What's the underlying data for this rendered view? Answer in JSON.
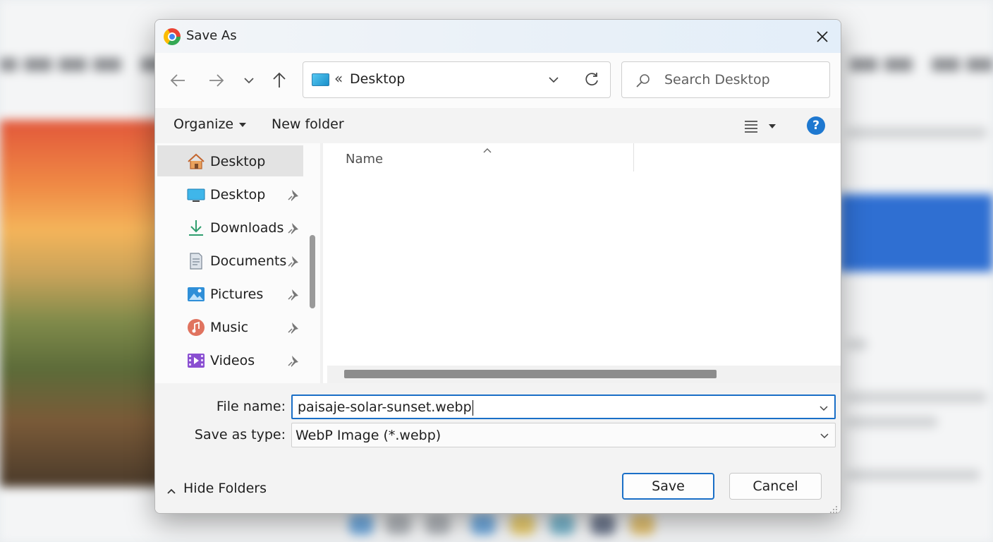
{
  "dialog": {
    "title": "Save As",
    "app_icon": "chrome-icon"
  },
  "navigation": {
    "back_icon": "arrow-left-icon",
    "forward_icon": "arrow-right-icon",
    "recent_icon": "chevron-down-icon",
    "up_icon": "arrow-up-icon",
    "address": {
      "separator": "«",
      "location": "Desktop",
      "location_icon": "monitor-icon"
    },
    "search_placeholder": "Search Desktop"
  },
  "commands": {
    "organize": "Organize",
    "new_folder": "New folder",
    "help": "?"
  },
  "sidebar": {
    "items": [
      {
        "label": "Desktop",
        "icon": "home-icon",
        "pinned": false,
        "selected": true
      },
      {
        "label": "Desktop",
        "icon": "monitor-icon",
        "pinned": true,
        "selected": false
      },
      {
        "label": "Downloads",
        "icon": "download-icon",
        "pinned": true,
        "selected": false
      },
      {
        "label": "Documents",
        "icon": "document-icon",
        "pinned": true,
        "selected": false
      },
      {
        "label": "Pictures",
        "icon": "pictures-icon",
        "pinned": true,
        "selected": false
      },
      {
        "label": "Music",
        "icon": "music-icon",
        "pinned": true,
        "selected": false
      },
      {
        "label": "Videos",
        "icon": "videos-icon",
        "pinned": true,
        "selected": false
      }
    ]
  },
  "file_list": {
    "columns": [
      "Name"
    ],
    "rows": []
  },
  "form": {
    "file_name_label": "File name:",
    "file_name_value": "paisaje-solar-sunset.webp",
    "save_type_label": "Save as type:",
    "save_type_value": "WebP Image (*.webp)"
  },
  "footer": {
    "hide_folders": "Hide Folders",
    "save": "Save",
    "cancel": "Cancel"
  },
  "colors": {
    "accent": "#1a6fc7",
    "help": "#1e78d0"
  }
}
